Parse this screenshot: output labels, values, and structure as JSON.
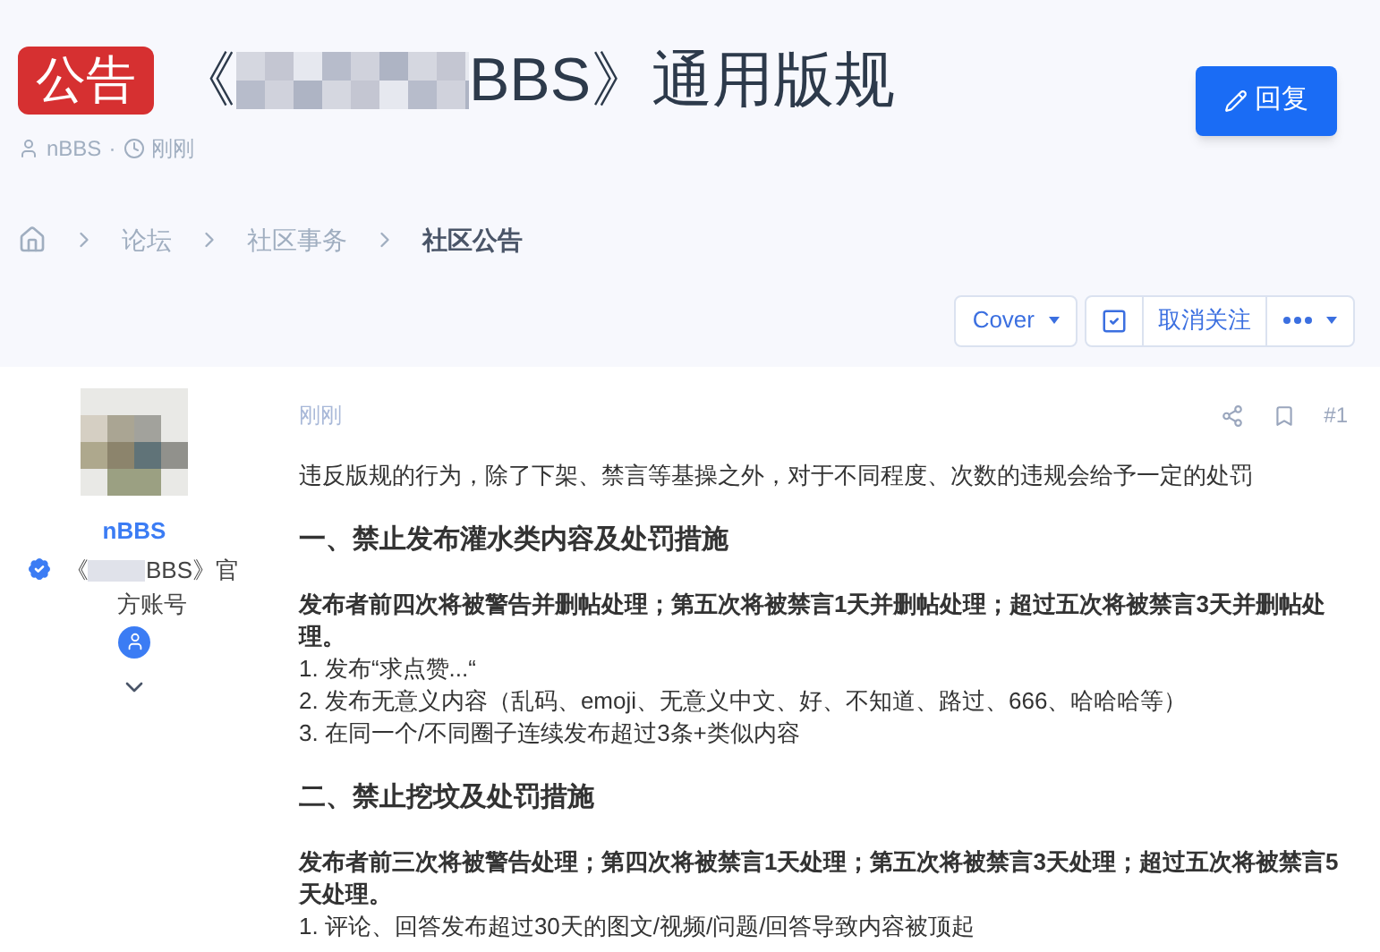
{
  "header": {
    "badge": "公告",
    "title_start": "《",
    "title_end": "BBS》通用版规",
    "author": "nBBS",
    "separator": "·",
    "time": "刚刚",
    "reply_button": "回复"
  },
  "breadcrumbs": [
    {
      "label": "论坛",
      "current": false
    },
    {
      "label": "社区事务",
      "current": false
    },
    {
      "label": "社区公告",
      "current": true
    }
  ],
  "toolbar": {
    "cover": "Cover",
    "follow_checked": true,
    "follow": "取消关注"
  },
  "post": {
    "user": {
      "name": "nBBS",
      "title_start": "《",
      "title_end": "BBS》官方账号"
    },
    "time": "刚刚",
    "number": "#1",
    "blocks": [
      {
        "kind": "paragraph",
        "text": "违反版规的行为，除了下架、禁言等基操之外，对于不同程度、次数的违规会给予一定的处罚"
      },
      {
        "kind": "heading",
        "text": "一、禁止发布灌水类内容及处罚措施"
      },
      {
        "kind": "strong",
        "text": "发布者前四次将被警告并删帖处理；第五次将被禁言1天并删帖处理；超过五次将被禁言3天并删帖处理。"
      },
      {
        "kind": "line",
        "text": "1. 发布“求点赞...“"
      },
      {
        "kind": "line",
        "text": "2. 发布无意义内容（乱码、emoji、无意义中文、好、不知道、路过、666、哈哈哈等）"
      },
      {
        "kind": "line",
        "text": "3. 在同一个/不同圈子连续发布超过3条+类似内容"
      },
      {
        "kind": "heading",
        "text": "二、禁止挖坟及处罚措施"
      },
      {
        "kind": "strong",
        "text": "发布者前三次将被警告处理；第四次将被禁言1天处理；第五次将被禁言3天处理；超过五次将被禁言5天处理。"
      },
      {
        "kind": "line",
        "text": "1. 评论、回答发布超过30天的图文/视频/问题/回答导致内容被顶起"
      }
    ]
  }
}
